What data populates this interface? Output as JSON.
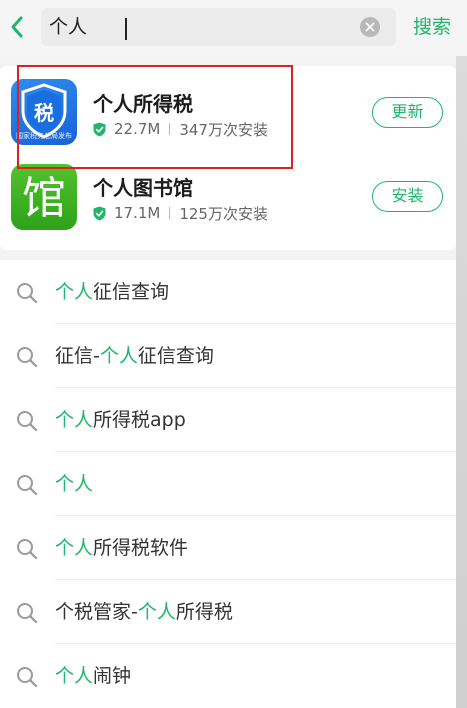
{
  "search": {
    "value": "个人",
    "submit_label": "搜索"
  },
  "results": [
    {
      "name": "个人所得税",
      "size": "22.7M",
      "installs": "347万次安装",
      "action": "更新",
      "icon_text": "税",
      "icon_caption": "国家税务总局发布"
    },
    {
      "name": "个人图书馆",
      "size": "17.1M",
      "installs": "125万次安装",
      "action": "安装",
      "icon_text": "馆"
    }
  ],
  "suggestions": [
    {
      "parts": [
        "",
        "个人",
        "征信查询"
      ]
    },
    {
      "parts": [
        "征信-",
        "个人",
        "征信查询"
      ]
    },
    {
      "parts": [
        "",
        "个人",
        "所得税app"
      ]
    },
    {
      "parts": [
        "",
        "个人",
        ""
      ]
    },
    {
      "parts": [
        "",
        "个人",
        "所得税软件"
      ]
    },
    {
      "parts": [
        "个税管家-",
        "个人",
        "所得税"
      ]
    },
    {
      "parts": [
        "",
        "个人",
        "闹钟"
      ]
    }
  ],
  "colors": {
    "accent": "#21b46c",
    "highlight_box": "#e02020"
  },
  "icons": [
    "back-chevron-icon",
    "clear-icon",
    "shield-check-icon",
    "search-icon"
  ]
}
